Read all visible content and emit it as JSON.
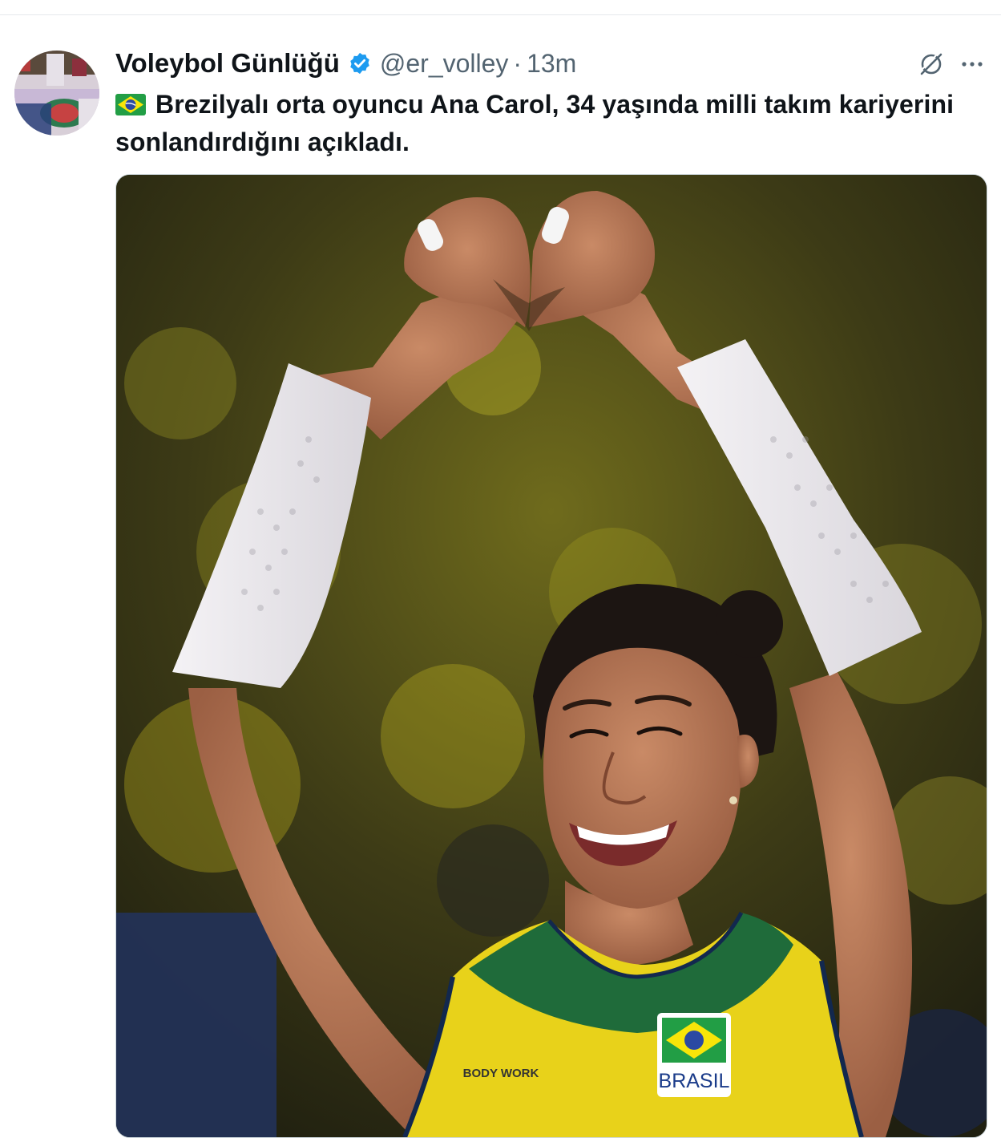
{
  "tweet": {
    "author": {
      "display_name": "Voleybol Günlüğü",
      "handle": "@er_volley",
      "verified": true
    },
    "separator": "·",
    "timestamp": "13m",
    "text_prefix_flag": "brazil-flag-emoji",
    "text": "Brezilyalı orta oyuncu Ana Carol, 34 yaşında milli takım kariyerini sonlandırdığını açıkladı.",
    "media": {
      "type": "photo",
      "jersey_text": "BRASIL",
      "sponsor_text": "BODY WORK"
    }
  },
  "icons": {
    "verified": "verified-badge-icon",
    "grok": "grok-icon",
    "more": "more-icon"
  },
  "colors": {
    "accent": "#1d9bf0",
    "text_primary": "#0f1419",
    "text_secondary": "#536471",
    "jersey_yellow": "#e8d21a",
    "jersey_green": "#1f6b3a"
  }
}
